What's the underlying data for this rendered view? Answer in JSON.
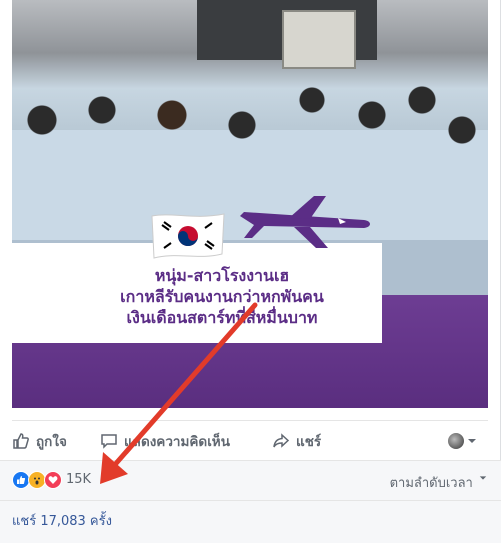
{
  "post": {
    "headline_line1": "หนุ่ม-สาวโรงงานเฮ",
    "headline_line2": "เกาหลีรับคนงานกว่าหกพันคน",
    "headline_line3": "เงินเดือนสตาร์ทที่สี่หมื่นบาท"
  },
  "actions": {
    "like_label": "ถูกใจ",
    "comment_label": "แสดงความคิดเห็น",
    "share_label": "แชร์"
  },
  "reactions": {
    "count": "15K",
    "sort_label": "ตามลำดับเวลา"
  },
  "shares": {
    "text": "แชร์ 17,083 ครั้ง"
  },
  "colors": {
    "facebook_blue": "#1877f2",
    "link_blue": "#365899",
    "arrow_red": "#e23b2a",
    "purple": "#5b2d86"
  },
  "icons": [
    "like-icon",
    "comment-icon",
    "share-icon",
    "avatar",
    "chevron-down-icon",
    "like-reaction-icon",
    "wow-reaction-icon",
    "love-reaction-icon",
    "annotation-arrow",
    "korea-flag-icon",
    "airplane-icon"
  ]
}
